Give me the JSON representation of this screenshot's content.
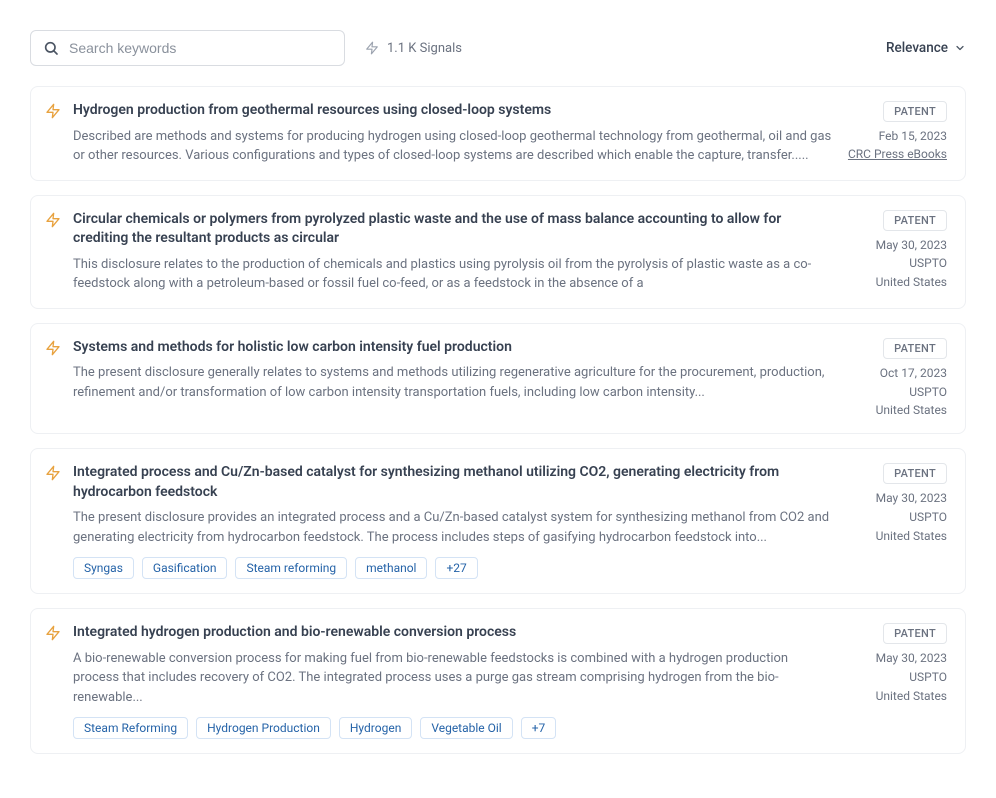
{
  "search": {
    "placeholder": "Search keywords"
  },
  "signals": {
    "count": "1.1 K Signals"
  },
  "sort": {
    "label": "Relevance"
  },
  "results": [
    {
      "title": "Hydrogen production from geothermal resources using closed-loop systems",
      "desc": "Described are methods and systems for producing hydrogen using closed-loop geothermal technology from geothermal, oil and gas or other resources. Various configurations and types of closed-loop systems are described which enable the capture, transfer.....",
      "badge": "PATENT",
      "date": "Feb 15, 2023",
      "source": "CRC Press eBooks",
      "source_link": true
    },
    {
      "title": "Circular chemicals or polymers from pyrolyzed plastic waste and the use of mass balance accounting to allow for crediting the resultant products as circular",
      "desc": "This disclosure relates to the production of chemicals and plastics using pyrolysis oil from the pyrolysis of plastic waste as a co-feedstock along with a petroleum-based or fossil fuel co-feed, or as a feedstock in the absence of a",
      "badge": "PATENT",
      "date": "May 30, 2023",
      "office": "USPTO",
      "country": "United States"
    },
    {
      "title": "Systems and methods for holistic low carbon intensity fuel production",
      "desc": "The present disclosure generally relates to systems and methods utilizing regenerative agriculture for the procurement, production, refinement and/or transformation of low carbon intensity transportation fuels, including low carbon intensity...",
      "badge": "PATENT",
      "date": "Oct 17, 2023",
      "office": "USPTO",
      "country": "United States"
    },
    {
      "title": "Integrated process and Cu/Zn-based catalyst for synthesizing methanol utilizing CO2, generating electricity from hydrocarbon feedstock",
      "desc": "The present disclosure provides an integrated process and a Cu/Zn-based catalyst system for synthesizing methanol from CO2 and generating electricity from hydrocarbon feedstock. The process includes steps of gasifying hydrocarbon feedstock into...",
      "badge": "PATENT",
      "date": "May 30, 2023",
      "office": "USPTO",
      "country": "United States",
      "tags": [
        "Syngas",
        "Gasification",
        "Steam reforming",
        "methanol",
        "+27"
      ]
    },
    {
      "title": "Integrated hydrogen production and bio-renewable conversion process",
      "desc": "A bio-renewable conversion process for making fuel from bio-renewable feedstocks is combined with a hydrogen production process that includes recovery of CO2. The integrated process uses a purge gas stream comprising hydrogen from the bio-renewable...",
      "badge": "PATENT",
      "date": "May 30, 2023",
      "office": "USPTO",
      "country": "United States",
      "tags": [
        "Steam Reforming",
        "Hydrogen Production",
        "Hydrogen",
        "Vegetable Oil",
        "+7"
      ]
    }
  ]
}
